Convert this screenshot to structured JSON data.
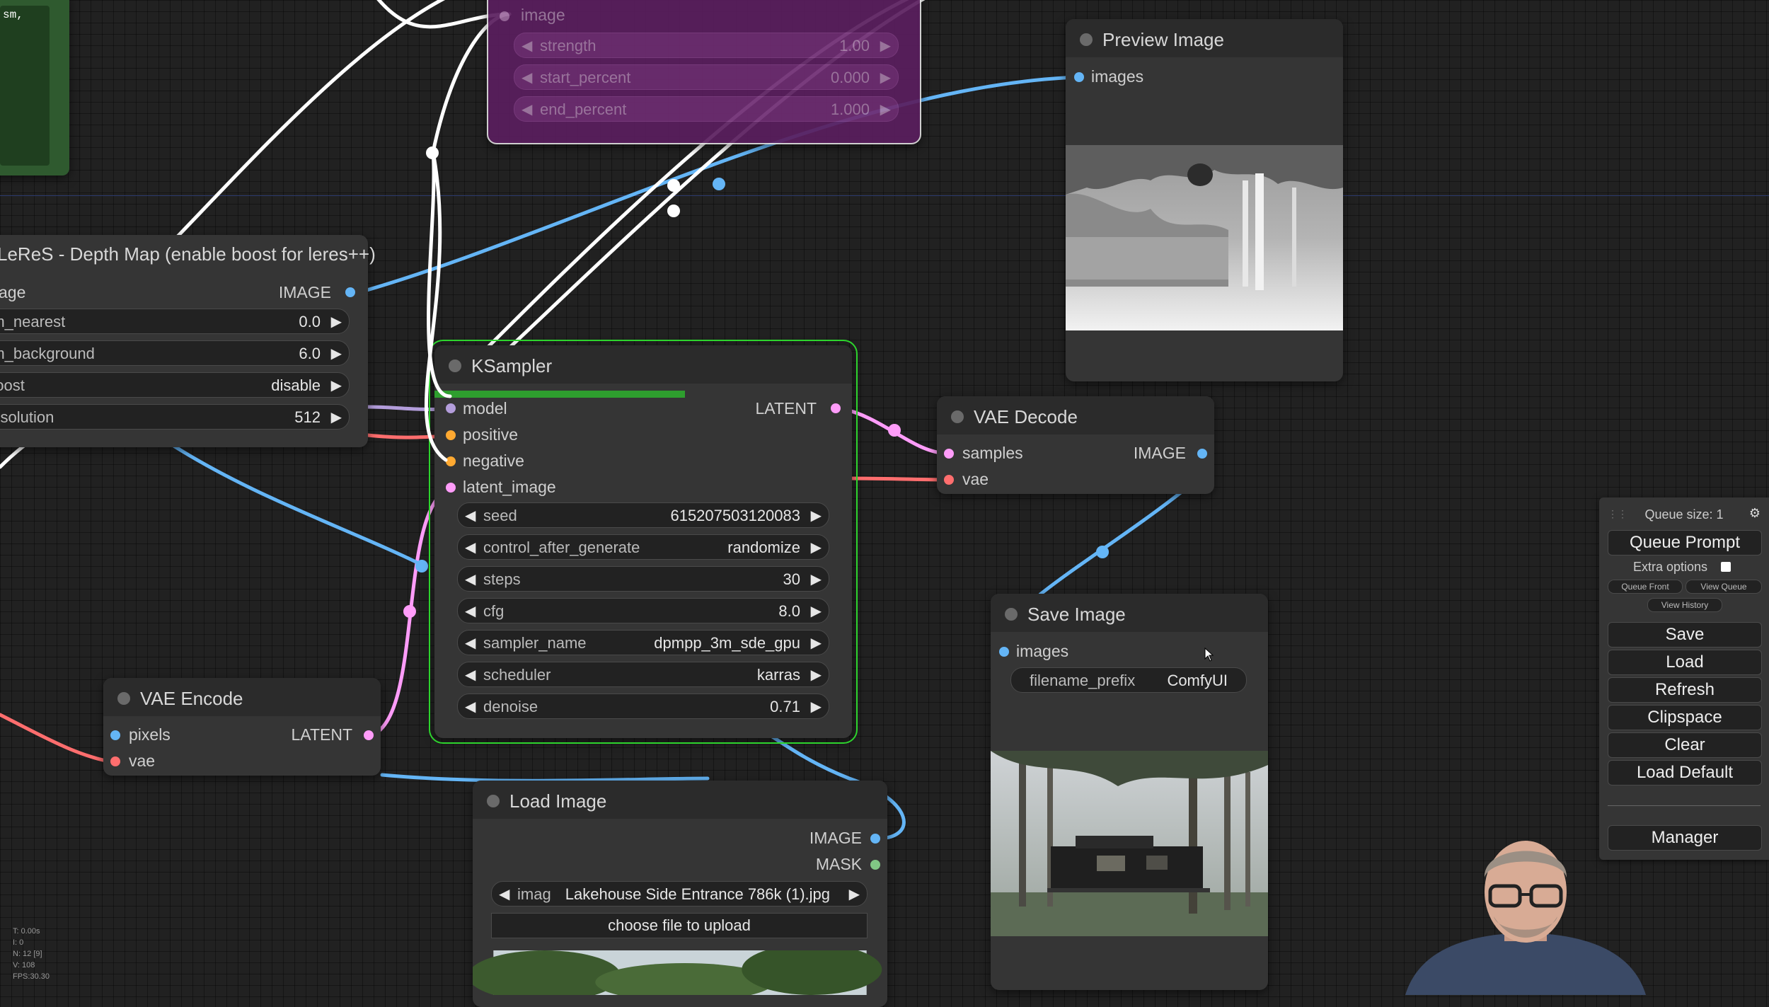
{
  "canvas": {
    "colors": {
      "background": "#212121",
      "node_body": "#353535",
      "node_header": "#2b2b2b",
      "selected_outline": "#2dd42d",
      "progress": "#2e9e2e",
      "image_wire": "#64b5f6",
      "latent_wire": "#ff9cf9",
      "vae_wire": "#ff6e6e",
      "model_wire": "#b39ddb",
      "conditioning_wire": "#ffa931"
    }
  },
  "top_left_node": {
    "text": "sm,"
  },
  "controlnet_node": {
    "input_image": "image",
    "widgets": [
      {
        "label": "strength",
        "value": "1.00"
      },
      {
        "label": "start_percent",
        "value": "0.000"
      },
      {
        "label": "end_percent",
        "value": "1.000"
      }
    ]
  },
  "leres_node": {
    "title": "LeReS - Depth Map (enable boost for leres++)",
    "input_label": "age",
    "output_label": "IMAGE",
    "widgets": [
      {
        "label": "rm_nearest",
        "value": "0.0"
      },
      {
        "label": "rm_background",
        "value": "6.0"
      },
      {
        "label": "boost",
        "value": "disable"
      },
      {
        "label": "resolution",
        "value": "512"
      }
    ]
  },
  "ksampler_node": {
    "title": "KSampler",
    "progress": 0.6,
    "inputs": [
      "model",
      "positive",
      "negative",
      "latent_image"
    ],
    "output": "LATENT",
    "widgets": [
      {
        "label": "seed",
        "value": "615207503120083"
      },
      {
        "label": "control_after_generate",
        "value": "randomize"
      },
      {
        "label": "steps",
        "value": "30"
      },
      {
        "label": "cfg",
        "value": "8.0"
      },
      {
        "label": "sampler_name",
        "value": "dpmpp_3m_sde_gpu"
      },
      {
        "label": "scheduler",
        "value": "karras"
      },
      {
        "label": "denoise",
        "value": "0.71"
      }
    ]
  },
  "preview_image_node": {
    "title": "Preview Image",
    "input": "images"
  },
  "vae_decode_node": {
    "title": "VAE Decode",
    "inputs": [
      "samples",
      "vae"
    ],
    "output": "IMAGE"
  },
  "save_image_node": {
    "title": "Save Image",
    "input": "images",
    "widget": {
      "label": "filename_prefix",
      "value": "ComfyUI"
    }
  },
  "vae_encode_node": {
    "title": "VAE Encode",
    "inputs": [
      "pixels",
      "vae"
    ],
    "output": "LATENT"
  },
  "load_image_node": {
    "title": "Load Image",
    "outputs": [
      "IMAGE",
      "MASK"
    ],
    "widget": {
      "label": "imag",
      "value": "Lakehouse Side Entrance 786k (1).jpg"
    },
    "upload_label": "choose file to upload"
  },
  "queue_panel": {
    "queue_size": "Queue size: 1",
    "queue_prompt": "Queue Prompt",
    "extra_options": "Extra options",
    "queue_front": "Queue Front",
    "view_queue": "View Queue",
    "view_history": "View History",
    "save": "Save",
    "load": "Load",
    "refresh": "Refresh",
    "clipspace": "Clipspace",
    "clear": "Clear",
    "load_default": "Load Default",
    "manager": "Manager"
  },
  "stats": {
    "time": "T: 0.00s",
    "iter": "I: 0",
    "nodes": "N: 12 [9]",
    "verts": "V: 108",
    "fps": "FPS:30.30"
  }
}
